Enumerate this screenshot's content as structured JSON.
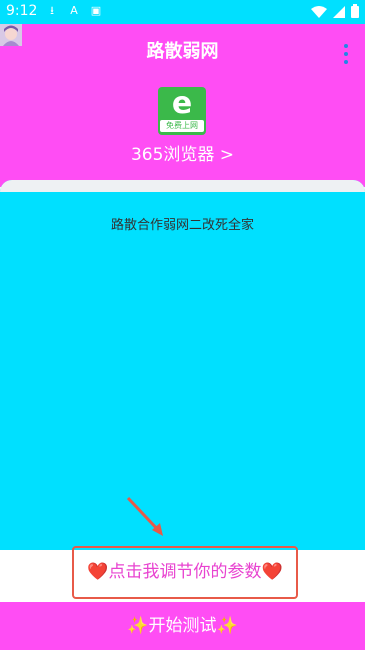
{
  "status_bar": {
    "time": "9:12",
    "left_icons": [
      "download-icon",
      "font-app-icon",
      "notification-icon"
    ],
    "right_icons": [
      "wifi-icon",
      "signal-icon",
      "battery-icon"
    ]
  },
  "app_bar": {
    "title": "路散弱网",
    "menu_icon": "more-vert-icon"
  },
  "header": {
    "logo_letter": "e",
    "logo_badge": "免费上网",
    "browser_link": "365浏览器 >"
  },
  "card": {
    "text": "路散合作弱网二改死全家"
  },
  "params": {
    "label": "❤️点击我调节你的参数❤️"
  },
  "actions": {
    "start_label": "✨开始测试✨"
  },
  "colors": {
    "pink": "#ff4df4",
    "cyan": "#00e0ff",
    "logo_green": "#3bb94a",
    "highlight_red": "#e85a48",
    "param_text": "#e843d0"
  }
}
